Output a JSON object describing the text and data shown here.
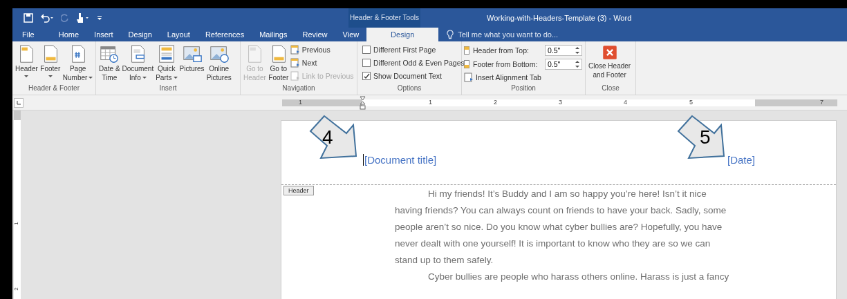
{
  "window": {
    "context_group": "Header & Footer Tools",
    "title": "Working-with-Headers-Template (3) - Word"
  },
  "tabs": [
    {
      "label": "File",
      "selected": false
    },
    {
      "label": "Home",
      "selected": false
    },
    {
      "label": "Insert",
      "selected": false
    },
    {
      "label": "Design",
      "selected": false
    },
    {
      "label": "Layout",
      "selected": false
    },
    {
      "label": "References",
      "selected": false
    },
    {
      "label": "Mailings",
      "selected": false
    },
    {
      "label": "Review",
      "selected": false
    },
    {
      "label": "View",
      "selected": false
    },
    {
      "label": "Design",
      "selected": true
    }
  ],
  "tell_me": {
    "placeholder": "Tell me what you want to do..."
  },
  "ribbon_groups": [
    {
      "label": "Header & Footer",
      "items": [
        {
          "kind": "large",
          "lines": [
            "Header"
          ],
          "dropdown": true,
          "disabled": false
        },
        {
          "kind": "large",
          "lines": [
            "Footer"
          ],
          "dropdown": true,
          "disabled": false
        },
        {
          "kind": "large",
          "lines": [
            "Page",
            "Number"
          ],
          "dropdown": true,
          "disabled": false
        }
      ]
    },
    {
      "label": "Insert",
      "items": [
        {
          "kind": "large",
          "lines": [
            "Date &",
            "Time"
          ],
          "dropdown": false,
          "disabled": false
        },
        {
          "kind": "large",
          "lines": [
            "Document",
            "Info"
          ],
          "dropdown": true,
          "disabled": false
        },
        {
          "kind": "large",
          "lines": [
            "Quick",
            "Parts"
          ],
          "dropdown": true,
          "disabled": false
        },
        {
          "kind": "large",
          "lines": [
            "Pictures"
          ],
          "dropdown": false,
          "disabled": false
        },
        {
          "kind": "large",
          "lines": [
            "Online",
            "Pictures"
          ],
          "dropdown": false,
          "disabled": false
        }
      ]
    },
    {
      "label": "Navigation",
      "items": [
        {
          "kind": "large",
          "lines": [
            "Go to",
            "Header"
          ],
          "dropdown": false,
          "disabled": true
        },
        {
          "kind": "large",
          "lines": [
            "Go to",
            "Footer"
          ],
          "dropdown": false,
          "disabled": false
        },
        {
          "kind": "small",
          "label": "Previous",
          "disabled": false
        },
        {
          "kind": "small",
          "label": "Next",
          "disabled": false
        },
        {
          "kind": "small",
          "label": "Link to Previous",
          "disabled": true
        }
      ]
    },
    {
      "label": "Options",
      "items": [
        {
          "kind": "checkbox",
          "label": "Different First Page",
          "checked": false
        },
        {
          "kind": "checkbox",
          "label": "Different Odd & Even Pages",
          "checked": false
        },
        {
          "kind": "checkbox",
          "label": "Show Document Text",
          "checked": true
        }
      ]
    },
    {
      "label": "Position",
      "items": [
        {
          "kind": "spin",
          "label": "Header from Top:",
          "value": "0.5\""
        },
        {
          "kind": "spin",
          "label": "Footer from Bottom:",
          "value": "0.5\""
        },
        {
          "kind": "small",
          "label": "Insert Alignment Tab",
          "disabled": false
        }
      ]
    },
    {
      "label": "Close",
      "items": [
        {
          "kind": "large",
          "lines": [
            "Close Header",
            "and Footer"
          ],
          "dropdown": false,
          "disabled": false
        }
      ]
    }
  ],
  "ruler": {
    "labels": [
      "1",
      "1",
      "2",
      "3",
      "4",
      "5",
      "7"
    ]
  },
  "vertical_ruler": {
    "labels": [
      "1",
      "2"
    ]
  },
  "page": {
    "header_title": "[Document title]",
    "header_date": "[Date]",
    "header_tag": "Header",
    "callouts": [
      {
        "label": "4"
      },
      {
        "label": "5"
      }
    ],
    "body_lines": [
      {
        "text": "Hi my friends! It’s Buddy and I am so happy you’re here! Isn’t it nice",
        "indent": true
      },
      {
        "text": "having friends? You can always count on friends to have your back. Sadly, some",
        "indent": false
      },
      {
        "text": "people aren’t so nice. Do you know what cyber bullies are? Hopefully, you have",
        "indent": false
      },
      {
        "text": "never dealt with one yourself! It is important to know who they are so we can",
        "indent": false
      },
      {
        "text": "stand up to them safely.",
        "indent": false
      },
      {
        "text": "Cyber bullies are people who harass others online. Harass is just a fancy",
        "indent": true
      }
    ]
  }
}
